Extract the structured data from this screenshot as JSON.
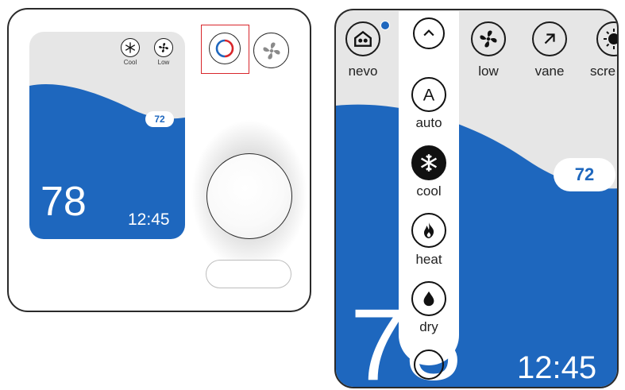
{
  "left_device": {
    "mini_screen": {
      "icons": [
        {
          "name": "snowflake-icon",
          "label": "Cool"
        },
        {
          "name": "fan-icon",
          "label": "Low"
        }
      ],
      "setpoint": "72",
      "current_temp": "78",
      "time": "12:45"
    },
    "mode_button_icon": "mode-ring-icon",
    "fan_button_icon": "fan-icon",
    "highlight_color": "#d8262b"
  },
  "zoom_screen": {
    "top_bar": [
      {
        "id": "nevo",
        "label": "nevo",
        "icon": "home-icon"
      },
      {
        "id": "low",
        "label": "low",
        "icon": "fan-icon"
      },
      {
        "id": "vane",
        "label": "vane",
        "icon": "vane-arrow-icon"
      },
      {
        "id": "screen",
        "label": "scre",
        "icon": "brightness-icon"
      }
    ],
    "mode_menu": {
      "collapse_icon": "chevron-up-icon",
      "items": [
        {
          "label": "auto",
          "icon": "auto-a-icon",
          "selected": false
        },
        {
          "label": "cool",
          "icon": "snowflake-icon",
          "selected": true
        },
        {
          "label": "heat",
          "icon": "flame-icon",
          "selected": false
        },
        {
          "label": "dry",
          "icon": "droplet-icon",
          "selected": false
        }
      ]
    },
    "setpoint": "72",
    "current_temp": "78",
    "time": "12:45"
  },
  "colors": {
    "accent_blue": "#1e67be",
    "background_gray": "#e6e6e6",
    "selection_red": "#d8262b"
  }
}
